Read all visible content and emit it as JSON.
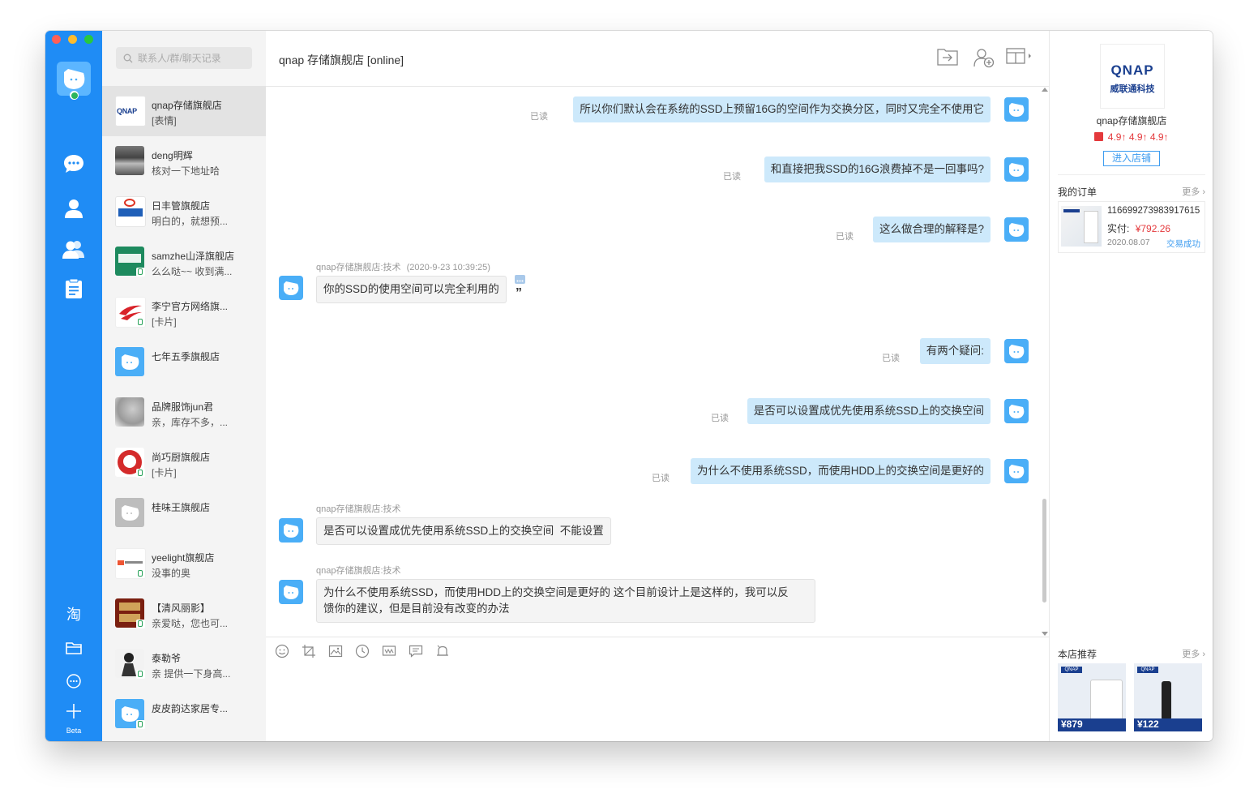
{
  "rail": {
    "beta_label": "Beta",
    "tao_label": "淘"
  },
  "search": {
    "placeholder": "联系人/群/聊天记录"
  },
  "contacts": [
    {
      "name": "qnap存储旗舰店",
      "msg": "[表情]"
    },
    {
      "name": "deng明辉",
      "msg": "核对一下地址哈"
    },
    {
      "name": "日丰管旗舰店",
      "msg": "明白的，就想预..."
    },
    {
      "name": "samzhe山泽旗舰店",
      "msg": "么么哒~~ 收到满..."
    },
    {
      "name": "李宁官方网络旗...",
      "msg": "[卡片]"
    },
    {
      "name": "七年五季旗舰店",
      "msg": ""
    },
    {
      "name": "品牌服饰jun君",
      "msg": "亲，库存不多，..."
    },
    {
      "name": "尚巧厨旗舰店",
      "msg": "[卡片]"
    },
    {
      "name": "桂味王旗舰店",
      "msg": ""
    },
    {
      "name": "yeelight旗舰店",
      "msg": "没事的奥"
    },
    {
      "name": "【清风丽影】",
      "msg": "亲爱哒，您也可..."
    },
    {
      "name": "泰勒爷",
      "msg": "亲 提供一下身高..."
    },
    {
      "name": "皮皮韵达家居专...",
      "msg": ""
    }
  ],
  "chat": {
    "title": "qnap 存储旗舰店 [online]",
    "read_label": "已读",
    "messages": [
      {
        "text": "所以你们默认会在系统的SSD上预留16G的空间作为交换分区，同时又完全不使用它"
      },
      {
        "text": "和直接把我SSD的16G浪费掉不是一回事吗?"
      },
      {
        "text": "这么做合理的解释是?"
      },
      {
        "sender": "qnap存储旗舰店:技术",
        "time": "(2020-9-23 10:39:25)",
        "text": "你的SSD的使用空间可以完全利用的"
      },
      {
        "text": "有两个疑问:"
      },
      {
        "text": "是否可以设置成优先使用系统SSD上的交换空间"
      },
      {
        "text": "为什么不使用系统SSD，而使用HDD上的交换空间是更好的"
      },
      {
        "sender": "qnap存储旗舰店:技术",
        "text": "是否可以设置成优先使用系统SSD上的交换空间  不能设置"
      },
      {
        "sender": "qnap存储旗舰店:技术",
        "text": "为什么不使用系统SSD，而使用HDD上的交换空间是更好的 这个目前设计上是这样的，我可以反",
        "text2": "馈你的建议，但是目前没有改变的办法"
      }
    ]
  },
  "shop": {
    "logo_text": "QNAP",
    "logo_sub": "威联通科技",
    "name": "qnap存储旗舰店",
    "ratings": [
      "4.9↑",
      "4.9↑",
      "4.9↑"
    ],
    "enter_button": "进入店铺"
  },
  "orders": {
    "title": "我的订单",
    "more": "更多 ›",
    "order_no": "116699273983917615",
    "paid_label": "实付:",
    "paid_value": "¥792.26",
    "date": "2020.08.07",
    "status": "交易成功"
  },
  "recommend": {
    "title": "本店推荐",
    "more": "更多 ›",
    "items": [
      {
        "price": "¥879",
        "brand": "QNAP"
      },
      {
        "price": "¥122",
        "brand": "QNAP"
      }
    ]
  },
  "colors": {
    "rail": "#1f8cf5",
    "bubble_me": "#cde9fb",
    "price": "#e4393c",
    "link": "#3d9cf0"
  }
}
